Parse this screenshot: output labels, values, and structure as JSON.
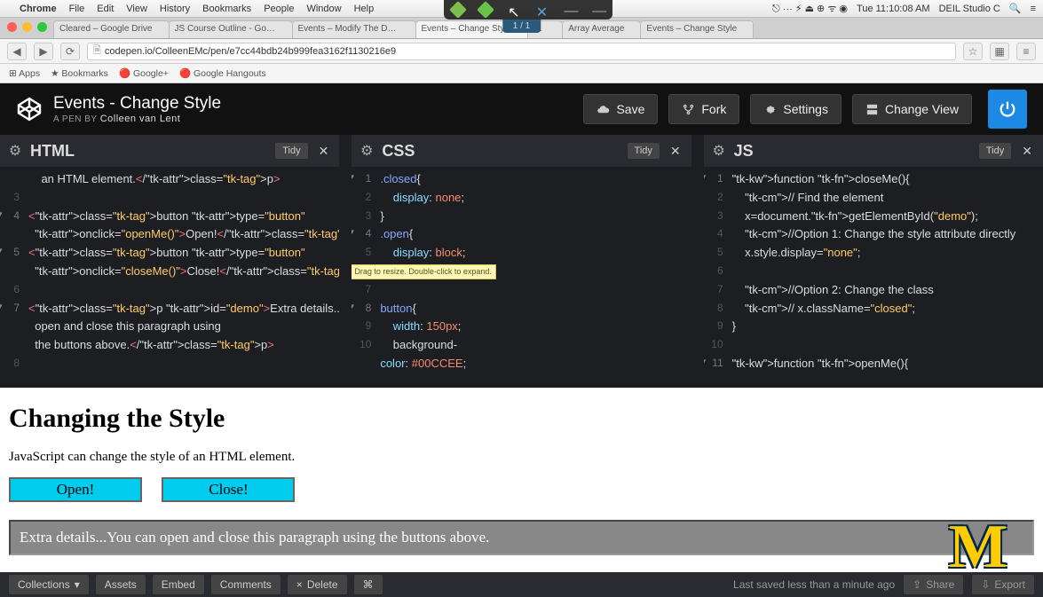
{
  "menubar": {
    "app": "Chrome",
    "items": [
      "File",
      "Edit",
      "View",
      "History",
      "Bookmarks",
      "People",
      "Window",
      "Help"
    ],
    "clock": "Tue 11:10:08 AM",
    "user": "DEIL Studio C"
  },
  "browser": {
    "tabs": [
      "Cleared – Google Drive",
      "JS Course Outline - Goo…",
      "Events – Modify The DOM …",
      "Events – Change Style",
      "…",
      "Array Average",
      "Events – Change Style"
    ],
    "active_tab": 3,
    "pagecount": "1 / 1",
    "url": "codepen.io/ColleenEMc/pen/e7cc44bdb24b999fea3162f1130216e9",
    "bookmarks": [
      "Apps",
      "Bookmarks",
      "Google+",
      "Google Hangouts"
    ]
  },
  "codepen": {
    "title": "Events - Change Style",
    "sub_prefix": "A PEN BY",
    "author": "Colleen van Lent",
    "buttons": {
      "save": "Save",
      "fork": "Fork",
      "settings": "Settings",
      "changeview": "Change View"
    }
  },
  "panes": {
    "tidy": "Tidy",
    "html": {
      "title": "HTML"
    },
    "css": {
      "title": "CSS"
    },
    "js": {
      "title": "JS"
    },
    "resize_tip": "Drag to resize.\nDouble-click to expand."
  },
  "code": {
    "html_lines": [
      "    an HTML element.</p>",
      "",
      "<button type=\"button\"",
      "  onclick=\"openMe()\">Open!</button>",
      "<button type=\"button\"",
      "  onclick=\"closeMe()\">Close!</button>",
      "",
      "<p id=\"demo\">Extra details...You can",
      "  open and close this paragraph using",
      "  the buttons above.</p>"
    ],
    "css_text": ".closed{\n    display: none;\n}\n.open{\n    display: block;\n}\n\nbutton{\n    width:150px;\n    background-\ncolor: #00CCEE;",
    "js_text": "function closeMe(){\n    // Find the element\n    x=document.getElementById(\"demo\");\n    //Option 1: Change the style attribute directly\n    x.style.display=\"none\";\n\n    //Option 2: Change the class\n    // x.className=\"closed\";\n}\n\nfunction openMe(){"
  },
  "preview": {
    "h1": "Changing the Style",
    "p": "JavaScript can change the style of an HTML element.",
    "open": "Open!",
    "close": "Close!",
    "demo": "Extra details...You can open and close this paragraph using the buttons above."
  },
  "footer": {
    "collections": "Collections",
    "assets": "Assets",
    "embed": "Embed",
    "comments": "Comments",
    "delete": "Delete",
    "saved": "Last saved less than a minute ago",
    "share": "Share",
    "export": "Export"
  }
}
